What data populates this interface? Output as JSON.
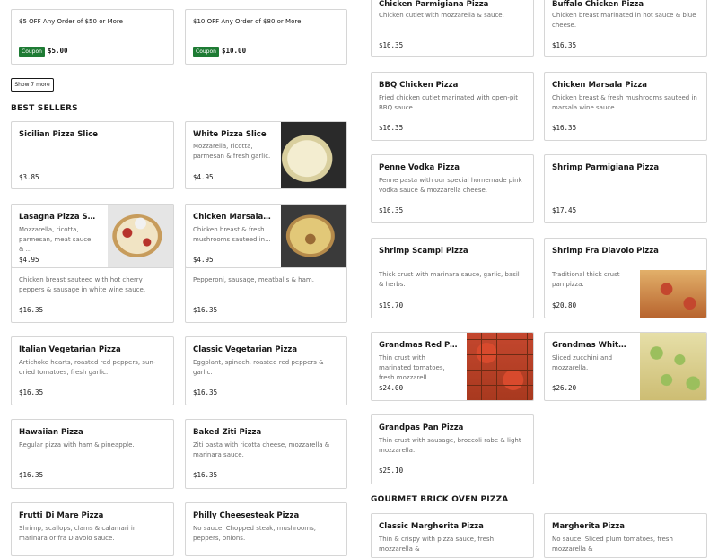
{
  "coupons": [
    {
      "title": "$5 OFF Any Order of $50 or More",
      "badge": "Coupon",
      "value": "$5.00"
    },
    {
      "title": "$10 OFF Any Order of $80 or More",
      "badge": "Coupon",
      "value": "$10.00"
    }
  ],
  "show_more_label": "Show 7 more",
  "best_sellers_title": "BEST SELLERS",
  "gourmet_title": "GOURMET BRICK OVEN PIZZA",
  "items": {
    "sicilian": {
      "name": "Sicilian Pizza Slice",
      "desc": "",
      "price": "$3.85"
    },
    "white_slice": {
      "name": "White Pizza Slice",
      "desc": "Mozzarella, ricotta, parmesan & fresh garlic.",
      "price": "$4.95"
    },
    "lasagna": {
      "name": "Lasagna Pizza Slice",
      "desc": "Mozzarella, ricotta, parmesan, meat sauce & ...",
      "price": "$4.95"
    },
    "masala_slice": {
      "name": "Chicken Marsala Pizza...",
      "desc": "Chicken breast & fresh mushrooms sauteed in...",
      "price": "$4.95"
    },
    "hidden_left": {
      "desc": "Chicken breast sauteed with hot cherry peppers & sausage in white wine sauce.",
      "price": "$16.35"
    },
    "hidden_right": {
      "desc": "Pepperoni, sausage, meatballs & ham.",
      "price": "$16.35"
    },
    "italian_veg": {
      "name": "Italian Vegetarian Pizza",
      "desc": "Artichoke hearts, roasted red peppers, sun-dried tomatoes, fresh garlic.",
      "price": "$16.35"
    },
    "classic_veg": {
      "name": "Classic Vegetarian Pizza",
      "desc": "Eggplant, spinach, roasted red peppers & garlic.",
      "price": "$16.35"
    },
    "hawaiian": {
      "name": "Hawaiian Pizza",
      "desc": "Regular pizza with ham & pineapple.",
      "price": "$16.35"
    },
    "baked_ziti": {
      "name": "Baked Ziti Pizza",
      "desc": "Ziti pasta with ricotta cheese, mozzarella & marinara sauce.",
      "price": "$16.35"
    },
    "frutti": {
      "name": "Frutti Di Mare Pizza",
      "desc": "Shrimp, scallops, clams & calamari in marinara or fra Diavolo sauce."
    },
    "philly": {
      "name": "Philly Cheesesteak Pizza",
      "desc": "No sauce. Chopped steak, mushrooms, peppers, onions."
    },
    "chicken_parm": {
      "name": "Chicken Parmigiana Pizza",
      "desc": "Chicken cutlet with mozzarella & sauce.",
      "price": "$16.35"
    },
    "buffalo": {
      "name": "Buffalo Chicken Pizza",
      "desc": "Chicken breast marinated in hot sauce & blue cheese.",
      "price": "$16.35"
    },
    "bbq": {
      "name": "BBQ Chicken Pizza",
      "desc": "Fried chicken cutlet marinated with open-pit BBQ sauce.",
      "price": "$16.35"
    },
    "chicken_marsala": {
      "name": "Chicken Marsala Pizza",
      "desc": "Chicken breast & fresh mushrooms sauteed in marsala wine sauce.",
      "price": "$16.35"
    },
    "penne_vodka": {
      "name": "Penne Vodka Pizza",
      "desc": "Penne pasta with our special homemade pink vodka sauce & mozzarella cheese.",
      "price": "$16.35"
    },
    "shrimp_parm": {
      "name": "Shrimp Parmigiana Pizza",
      "desc": "",
      "price": "$17.45"
    },
    "shrimp_scampi": {
      "name": "Shrimp Scampi Pizza",
      "desc": "Thick crust with marinara sauce, garlic, basil & herbs.",
      "price": "$19.70"
    },
    "shrimp_fra": {
      "name": "Shrimp Fra Diavolo Pizza",
      "desc": "Traditional thick crust pan pizza.",
      "price": "$20.80"
    },
    "grandmas_red": {
      "name": "Grandmas Red Pan...",
      "desc": "Thin crust with marinated tomatoes, fresh mozzarell...",
      "price": "$24.00"
    },
    "grandmas_white": {
      "name": "Grandmas White Pan...",
      "desc": "Sliced zucchini and mozzarella.",
      "price": "$26.20"
    },
    "grandpas": {
      "name": "Grandpas Pan Pizza",
      "desc": "Thin crust with sausage, broccoli rabe & light mozzarella.",
      "price": "$25.10"
    },
    "classic_margherita": {
      "name": "Classic Margherita Pizza",
      "desc": "Thin & crispy with pizza sauce, fresh mozzarella &"
    },
    "margherita": {
      "name": "Margherita Pizza",
      "desc": "No sauce. Sliced plum tomatoes, fresh mozzarella &"
    }
  }
}
